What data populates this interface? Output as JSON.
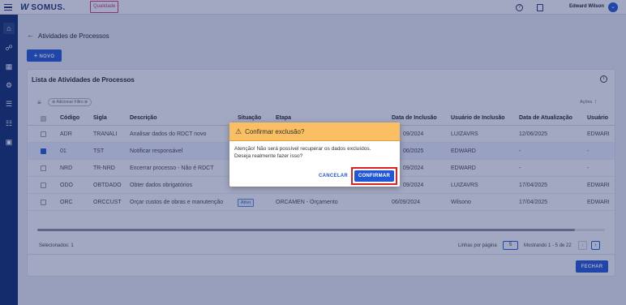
{
  "header": {
    "brand": "SOMUS.",
    "module_tag": "Qualidade",
    "user_name": "Edward Wilson"
  },
  "page": {
    "back_title": "Atividades de Processos",
    "new_button": "NOVO",
    "list_title": "Lista de Atividades de Processos",
    "add_filter": "Adicionar Filtro",
    "actions": "Ações",
    "footer_selected": "Selecionados: 1",
    "rows_per_page_label": "Linhas por página",
    "rows_per_page": "5",
    "showing": "Mostrando 1 - 5 de 22",
    "close_button": "FECHAR"
  },
  "table": {
    "headers": [
      "Código",
      "Sigla",
      "Descrição",
      "Situação",
      "Etapa",
      "Data de Inclusão",
      "Usuário de Inclusão",
      "Data de Atualização",
      "Usuário"
    ],
    "rows": [
      {
        "checked": false,
        "codigo": "ADR",
        "sigla": "TRANALI",
        "descricao": "Analisar dados do RDCT novo",
        "situacao": "",
        "etapa": "",
        "data_inclusao": "09/2024",
        "usuario_inclusao": "LUIZAVRS",
        "data_atualizacao": "12/06/2025",
        "usuario": "EDWARI"
      },
      {
        "checked": true,
        "codigo": "01",
        "sigla": "TST",
        "descricao": "Notificar responsável",
        "situacao": "",
        "etapa": "",
        "data_inclusao": "06/2025",
        "usuario_inclusao": "EDWARD",
        "data_atualizacao": "-",
        "usuario": "-"
      },
      {
        "checked": false,
        "codigo": "NRD",
        "sigla": "TR-NRD",
        "descricao": "Encerrar processo - Não é RDCT",
        "situacao": "",
        "etapa": "",
        "data_inclusao": "09/2024",
        "usuario_inclusao": "EDWARD",
        "data_atualizacao": "-",
        "usuario": "-"
      },
      {
        "checked": false,
        "codigo": "ODO",
        "sigla": "OBTDADO",
        "descricao": "Obter dados obrigatórios",
        "situacao": "",
        "etapa": "",
        "data_inclusao": "09/2024",
        "usuario_inclusao": "LUIZAVRS",
        "data_atualizacao": "17/04/2025",
        "usuario": "EDWARI"
      },
      {
        "checked": false,
        "codigo": "ORC",
        "sigla": "ORCCUST",
        "descricao": "Orçar custos de obras e manutenção",
        "situacao": "Ativo",
        "etapa": "ORCAMEN - Orçamento",
        "data_inclusao": "06/09/2024",
        "usuario_inclusao": "Wilsono",
        "data_atualizacao": "17/04/2025",
        "usuario": "EDWARI"
      }
    ]
  },
  "dialog": {
    "title": "Confirmar exclusão?",
    "message_line1": "Atenção! Não será possível recuperar os dados excluídos.",
    "message_line2": "Deseja realmente fazer isso?",
    "cancel": "CANCELAR",
    "confirm": "CONFIRMAR"
  },
  "colors": {
    "sidebar": "#0c2a6b",
    "primary": "#1f57d6",
    "warning_header": "#fbbf63",
    "confirm_highlight": "#e02020",
    "module_tag": "#d0347a"
  }
}
